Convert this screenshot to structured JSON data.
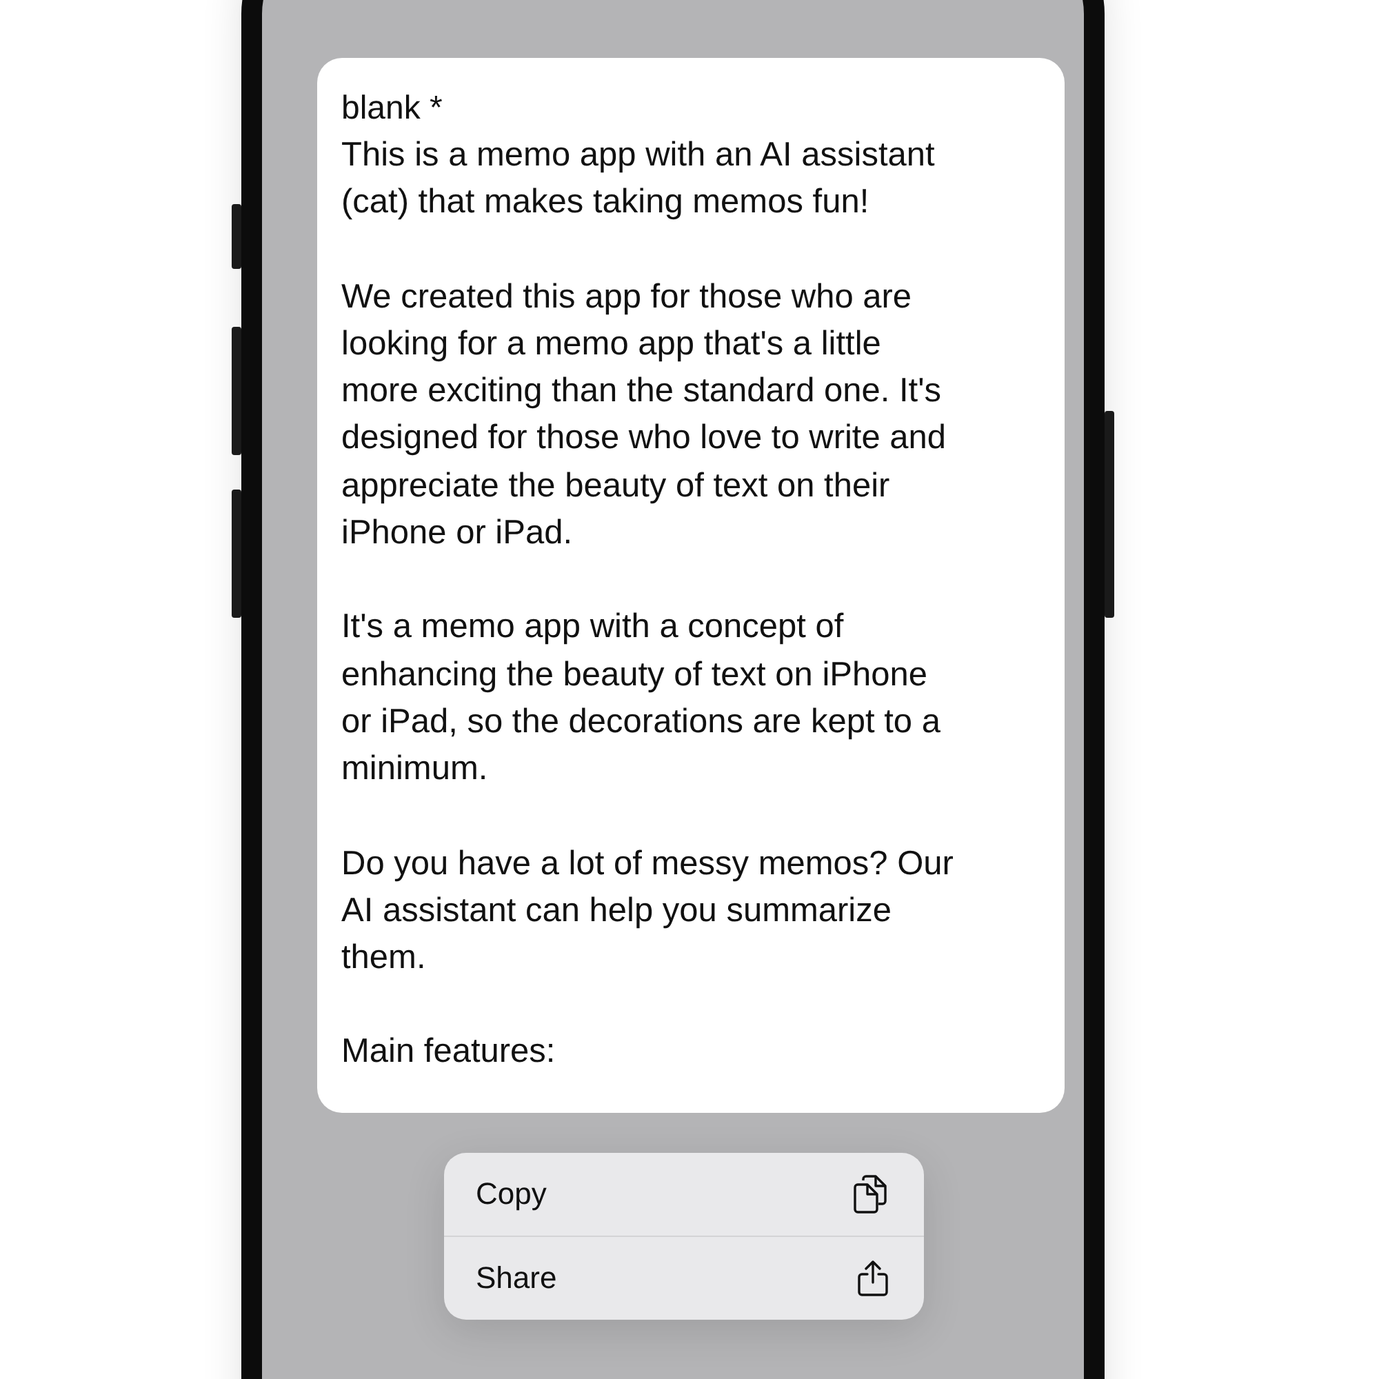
{
  "memo": {
    "title": "blank *",
    "paragraphs": [
      {
        "lines": [
          "This is a memo app with an AI assistant",
          "(cat) that makes taking memos fun!"
        ]
      },
      {
        "lines": [
          "We created this app for those who are",
          "looking for a memo app that's a little",
          "more exciting than the standard one. It's",
          "designed for those who love to write and",
          "appreciate the beauty of text on their",
          "iPhone or iPad."
        ]
      },
      {
        "lines": [
          "It's a memo app with a concept of",
          "enhancing the beauty of text on iPhone",
          "or iPad, so the decorations are kept to a",
          "minimum."
        ]
      },
      {
        "lines": [
          "Do you have a lot of messy memos? Our",
          "AI assistant can help you summarize",
          "them."
        ]
      },
      {
        "lines": [
          "Main features:"
        ]
      }
    ]
  },
  "menu": [
    {
      "label": "Copy",
      "kind": "copy"
    },
    {
      "label": "Share",
      "kind": "share"
    }
  ]
}
